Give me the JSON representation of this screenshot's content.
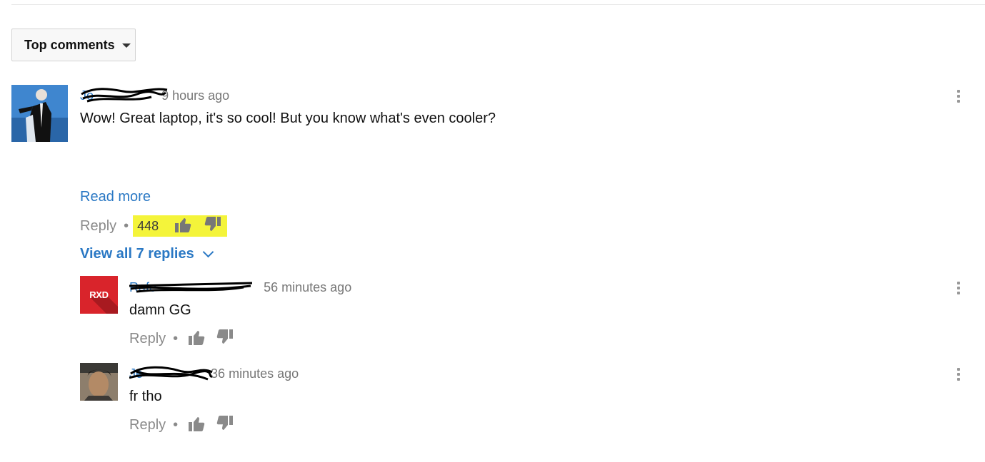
{
  "sort": {
    "label": "Top comments"
  },
  "comments": [
    {
      "author": "Jo",
      "time": "9 hours ago",
      "text": "Wow! Great laptop, it's so cool! But you know what's even cooler?",
      "read_more": "Read more",
      "reply_label": "Reply",
      "like_count": "448",
      "view_replies": "View all 7 replies"
    }
  ],
  "replies": [
    {
      "author": "Rafe",
      "avatar_text": "RXD",
      "time": "56 minutes ago",
      "text": "damn GG",
      "reply_label": "Reply"
    },
    {
      "author": "Je",
      "time": "36 minutes ago",
      "text": "fr tho",
      "reply_label": "Reply"
    }
  ],
  "colors": {
    "link": "#2a78c4",
    "highlight": "#f4f43a",
    "avatar_rxd": "#d9242b"
  }
}
